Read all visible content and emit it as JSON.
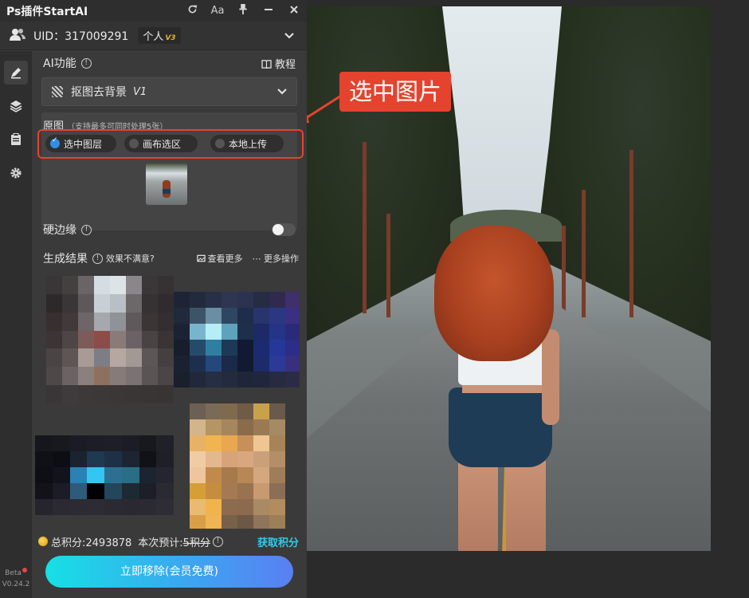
{
  "titlebar": {
    "title": "Ps插件StartAI",
    "refresh_icon": "refresh-icon",
    "font_label": "Aa",
    "pin_icon": "pin-icon",
    "minimize_icon": "minimize-icon",
    "close_icon": "close-icon"
  },
  "user": {
    "uid": "UID：317009291",
    "tier": "个人",
    "tier_badge": "V3"
  },
  "sidebar": {
    "items": [
      {
        "icon": "brush-icon",
        "active": true
      },
      {
        "icon": "layers-icon",
        "active": false
      },
      {
        "icon": "clipboard-icon",
        "active": false
      },
      {
        "icon": "gear-icon",
        "active": false
      }
    ],
    "beta": "Beta",
    "version": "V0.24.2"
  },
  "ai": {
    "label": "AI功能",
    "tutorial": "教程",
    "dropdown_value": "抠图去背景",
    "dropdown_version": "V1"
  },
  "origin": {
    "label": "原图",
    "hint": "（支持最多可同时处理5张）",
    "options": [
      "选中图层",
      "画布选区",
      "本地上传"
    ],
    "selected": 0
  },
  "hard_edge": {
    "label": "硬边缘",
    "enabled": false
  },
  "results": {
    "label": "生成结果",
    "unhappy": "效果不满意?",
    "view_more": "查看更多",
    "more_ops": "更多操作"
  },
  "footer": {
    "total_points": "总积分:2493878",
    "estimate_label": "本次预计:",
    "estimate_value": "5积分",
    "get_points": "获取积分",
    "cta": "立即移除(会员免费)"
  },
  "canvas": {
    "callout": "选中图片"
  },
  "colors": {
    "accent_red": "#e5432e",
    "accent_cyan": "#35c9e6",
    "selected_radio": "#2f8ee6"
  }
}
